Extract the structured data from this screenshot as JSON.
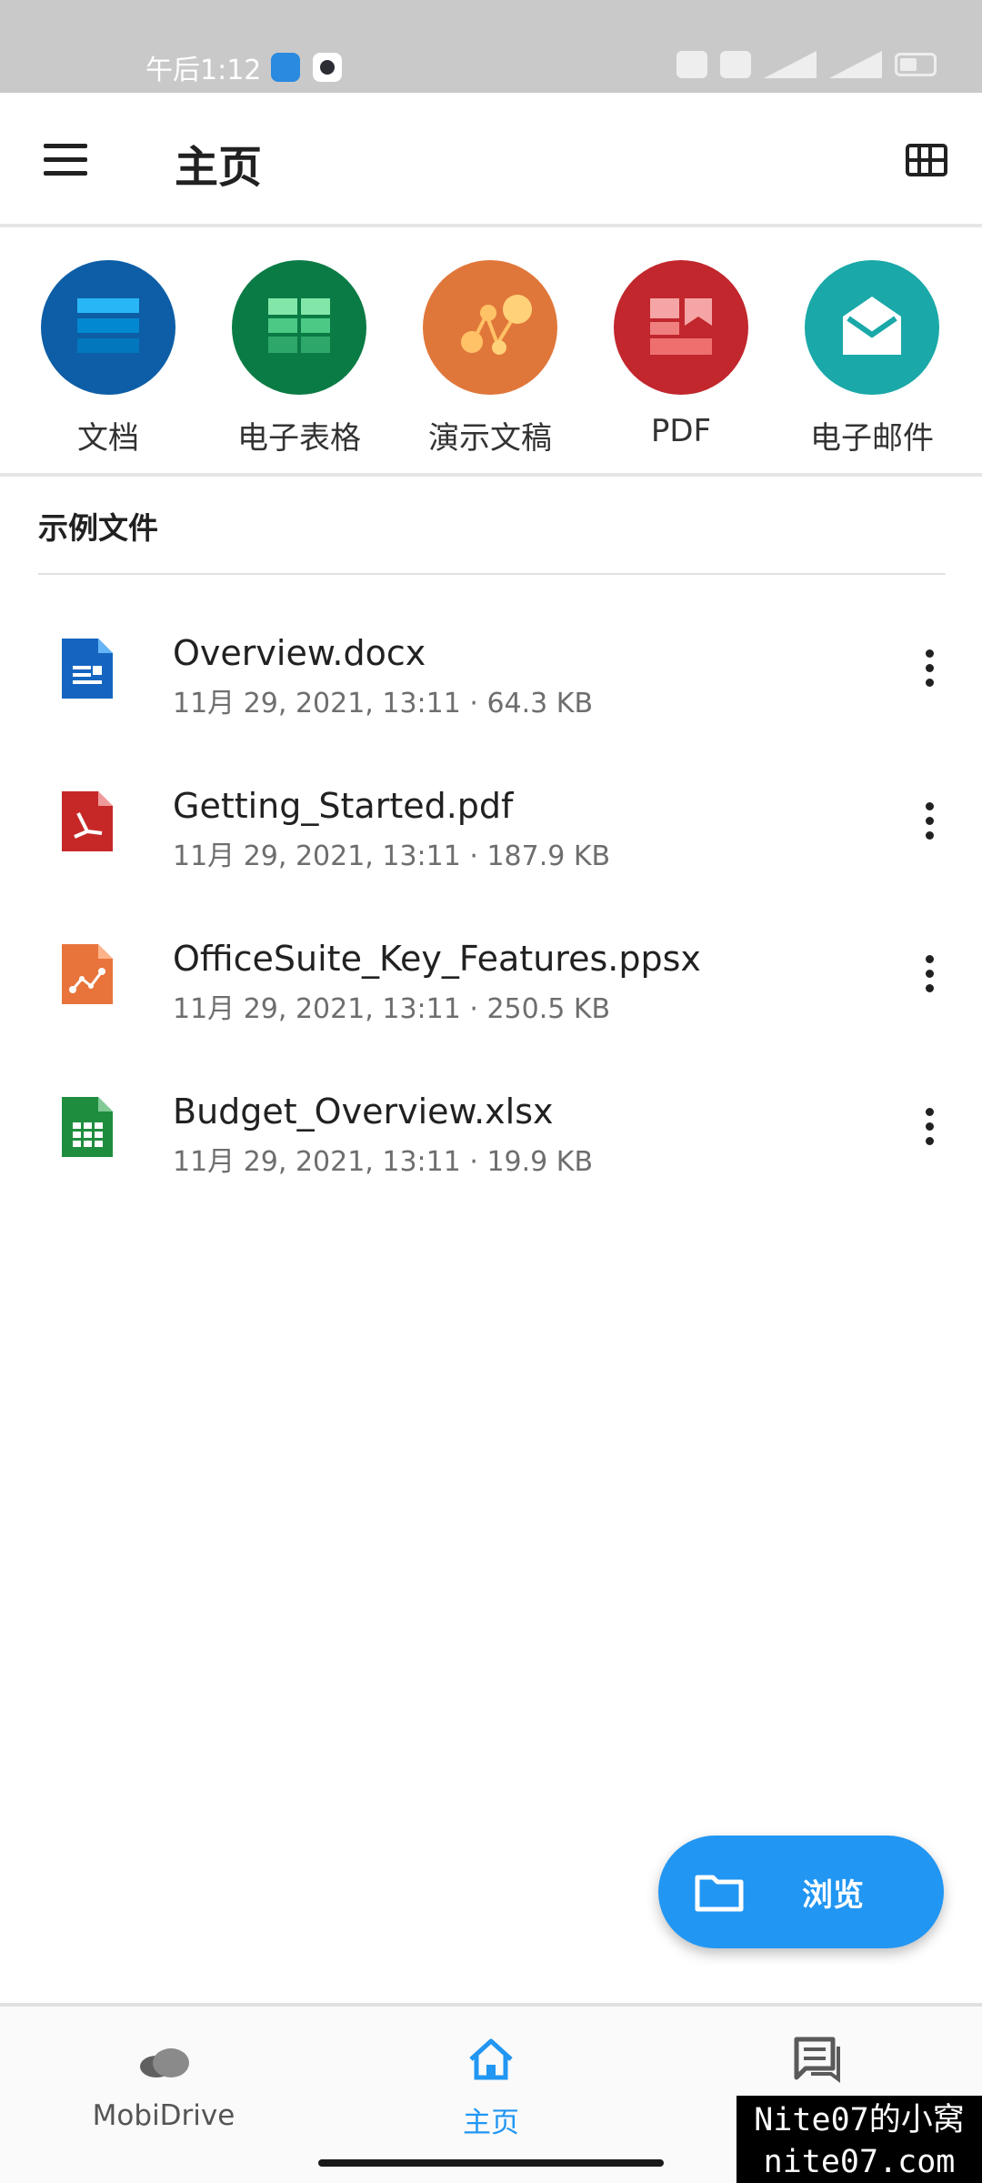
{
  "status_bar": {
    "time": "午后1:12"
  },
  "app_bar": {
    "title": "主页"
  },
  "categories": [
    {
      "label": "文档",
      "color": "#0d5ea6"
    },
    {
      "label": "电子表格",
      "color": "#0b7b45"
    },
    {
      "label": "演示文稿",
      "color": "#e0773a"
    },
    {
      "label": "PDF",
      "color": "#c1272d"
    },
    {
      "label": "电子邮件",
      "color": "#1aa8a8"
    }
  ],
  "section": {
    "title": "示例文件"
  },
  "files": [
    {
      "name": "Overview.docx",
      "meta": "11月 29, 2021, 13:11 · 64.3 KB",
      "icon": "docx-file-icon",
      "color": "#1565c0"
    },
    {
      "name": "Getting_Started.pdf",
      "meta": "11月 29, 2021, 13:11 · 187.9 KB",
      "icon": "pdf-file-icon",
      "color": "#c62828"
    },
    {
      "name": "OfficeSuite_Key_Features.ppsx",
      "meta": "11月 29, 2021, 13:11 · 250.5 KB",
      "icon": "ppsx-file-icon",
      "color": "#e8743b"
    },
    {
      "name": "Budget_Overview.xlsx",
      "meta": "11月 29, 2021, 13:11 · 19.9 KB",
      "icon": "xlsx-file-icon",
      "color": "#1e8e3e"
    }
  ],
  "fab": {
    "label": "浏览"
  },
  "bottom_nav": [
    {
      "label": "MobiDrive"
    },
    {
      "label": "主页"
    },
    {
      "label": ""
    }
  ],
  "watermark": {
    "line1": "Nite07的小窝",
    "line2": "nite07.com"
  }
}
